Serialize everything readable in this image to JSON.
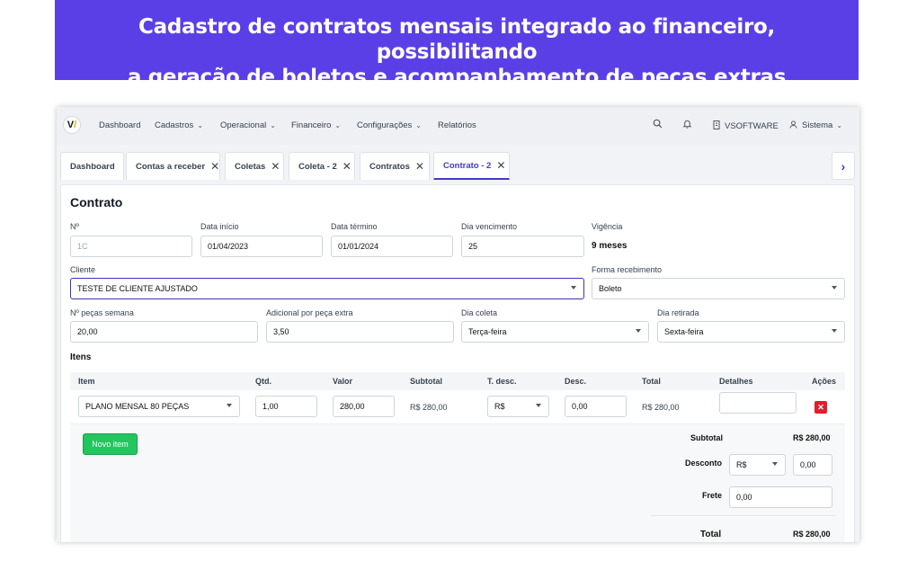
{
  "banner": {
    "line1": "Cadastro de contratos mensais integrado ao financeiro, possibilitando",
    "line2": "a geração de boletos e acompanhamento de peças extras"
  },
  "nav": {
    "logo": "V",
    "items": [
      "Dashboard",
      "Cadastros",
      "Operacional",
      "Financeiro",
      "Configurações",
      "Relatórios"
    ],
    "company": "VSOFTWARE",
    "user": "Sistema"
  },
  "tabs": [
    "Dashboard",
    "Contas a receber",
    "Coletas",
    "Coleta - 2",
    "Contratos",
    "Contrato - 2"
  ],
  "form": {
    "title": "Contrato",
    "numero_label": "Nº",
    "numero_value": "1C",
    "data_inicio_label": "Data início",
    "data_inicio_value": "01/04/2023",
    "data_termino_label": "Data término",
    "data_termino_value": "01/01/2024",
    "dia_vencimento_label": "Dia vencimento",
    "dia_vencimento_value": "25",
    "vigencia_label": "Vigência",
    "vigencia_value": "9 meses",
    "cliente_label": "Cliente",
    "cliente_value": "TESTE DE CLIENTE AJUSTADO",
    "forma_label": "Forma recebimento",
    "forma_value": "Boleto",
    "pecas_label": "Nº peças semana",
    "pecas_value": "20,00",
    "adicional_label": "Adicional por peça extra",
    "adicional_value": "3,50",
    "coleta_label": "Dia coleta",
    "coleta_value": "Terça-feira",
    "retirada_label": "Dia retirada",
    "retirada_value": "Sexta-feira"
  },
  "itens": {
    "section_title": "Itens",
    "headers": {
      "item": "Item",
      "qtd": "Qtd.",
      "valor": "Valor",
      "subtotal": "Subtotal",
      "tdesc": "T. desc.",
      "desc": "Desc.",
      "total": "Total",
      "detalhes": "Detalhes",
      "acoes": "Ações"
    },
    "row": {
      "item": "PLANO MENSAL 80 PEÇAS",
      "qtd": "1,00",
      "valor": "280,00",
      "subtotal": "R$ 280,00",
      "tdesc": "R$",
      "desc": "0,00",
      "total": "R$ 280,00",
      "detalhes": "",
      "delete_icon": "✕"
    },
    "novo_item": "Novo item"
  },
  "summary": {
    "subtotal_label": "Subtotal",
    "subtotal_value": "R$ 280,00",
    "desconto_label": "Desconto",
    "desconto_type": "R$",
    "desconto_value": "0,00",
    "frete_label": "Frete",
    "frete_value": "0,00",
    "total_label": "Total",
    "total_value": "R$ 280,00"
  }
}
